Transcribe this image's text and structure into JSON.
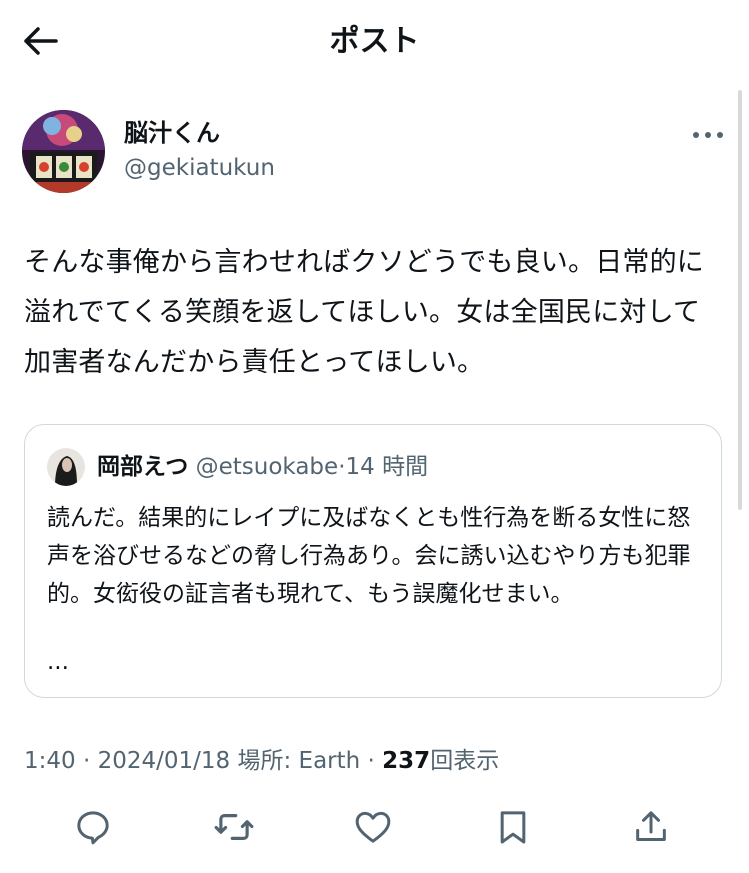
{
  "header": {
    "title": "ポスト"
  },
  "tweet": {
    "display_name": "脳汁くん",
    "handle": "@gekiatukun",
    "text": "そんな事俺から言わせればクソどうでも良い。日常的に溢れでてくる笑顔を返してほしい。女は全国民に対して加害者なんだから責任とってほしい。"
  },
  "quote": {
    "display_name": "岡部えつ",
    "handle": "@etsuokabe",
    "separator": "·",
    "time": "14 時間",
    "text": "読んだ。結果的にレイプに及ばなくとも性行為を断る女性に怒声を浴びせるなどの脅し行為あり。会に誘い込むやり方も犯罪的。女衒役の証言者も現れて、もう誤魔化せまい。",
    "ellipsis": "..."
  },
  "meta": {
    "time": "1:40",
    "sep1": " · ",
    "date": "2024/01/18",
    "location": " 場所: Earth",
    "sep2": " · ",
    "views_count": "237",
    "views_label": "回表示"
  },
  "icons": {
    "back": "arrow-left-icon",
    "more": "more-horizontal-icon",
    "reply": "reply-icon",
    "retweet": "retweet-icon",
    "like": "heart-icon",
    "bookmark": "bookmark-icon",
    "share": "share-icon"
  },
  "colors": {
    "text": "#0f1419",
    "secondary": "#536471",
    "border": "#cfd9de"
  }
}
